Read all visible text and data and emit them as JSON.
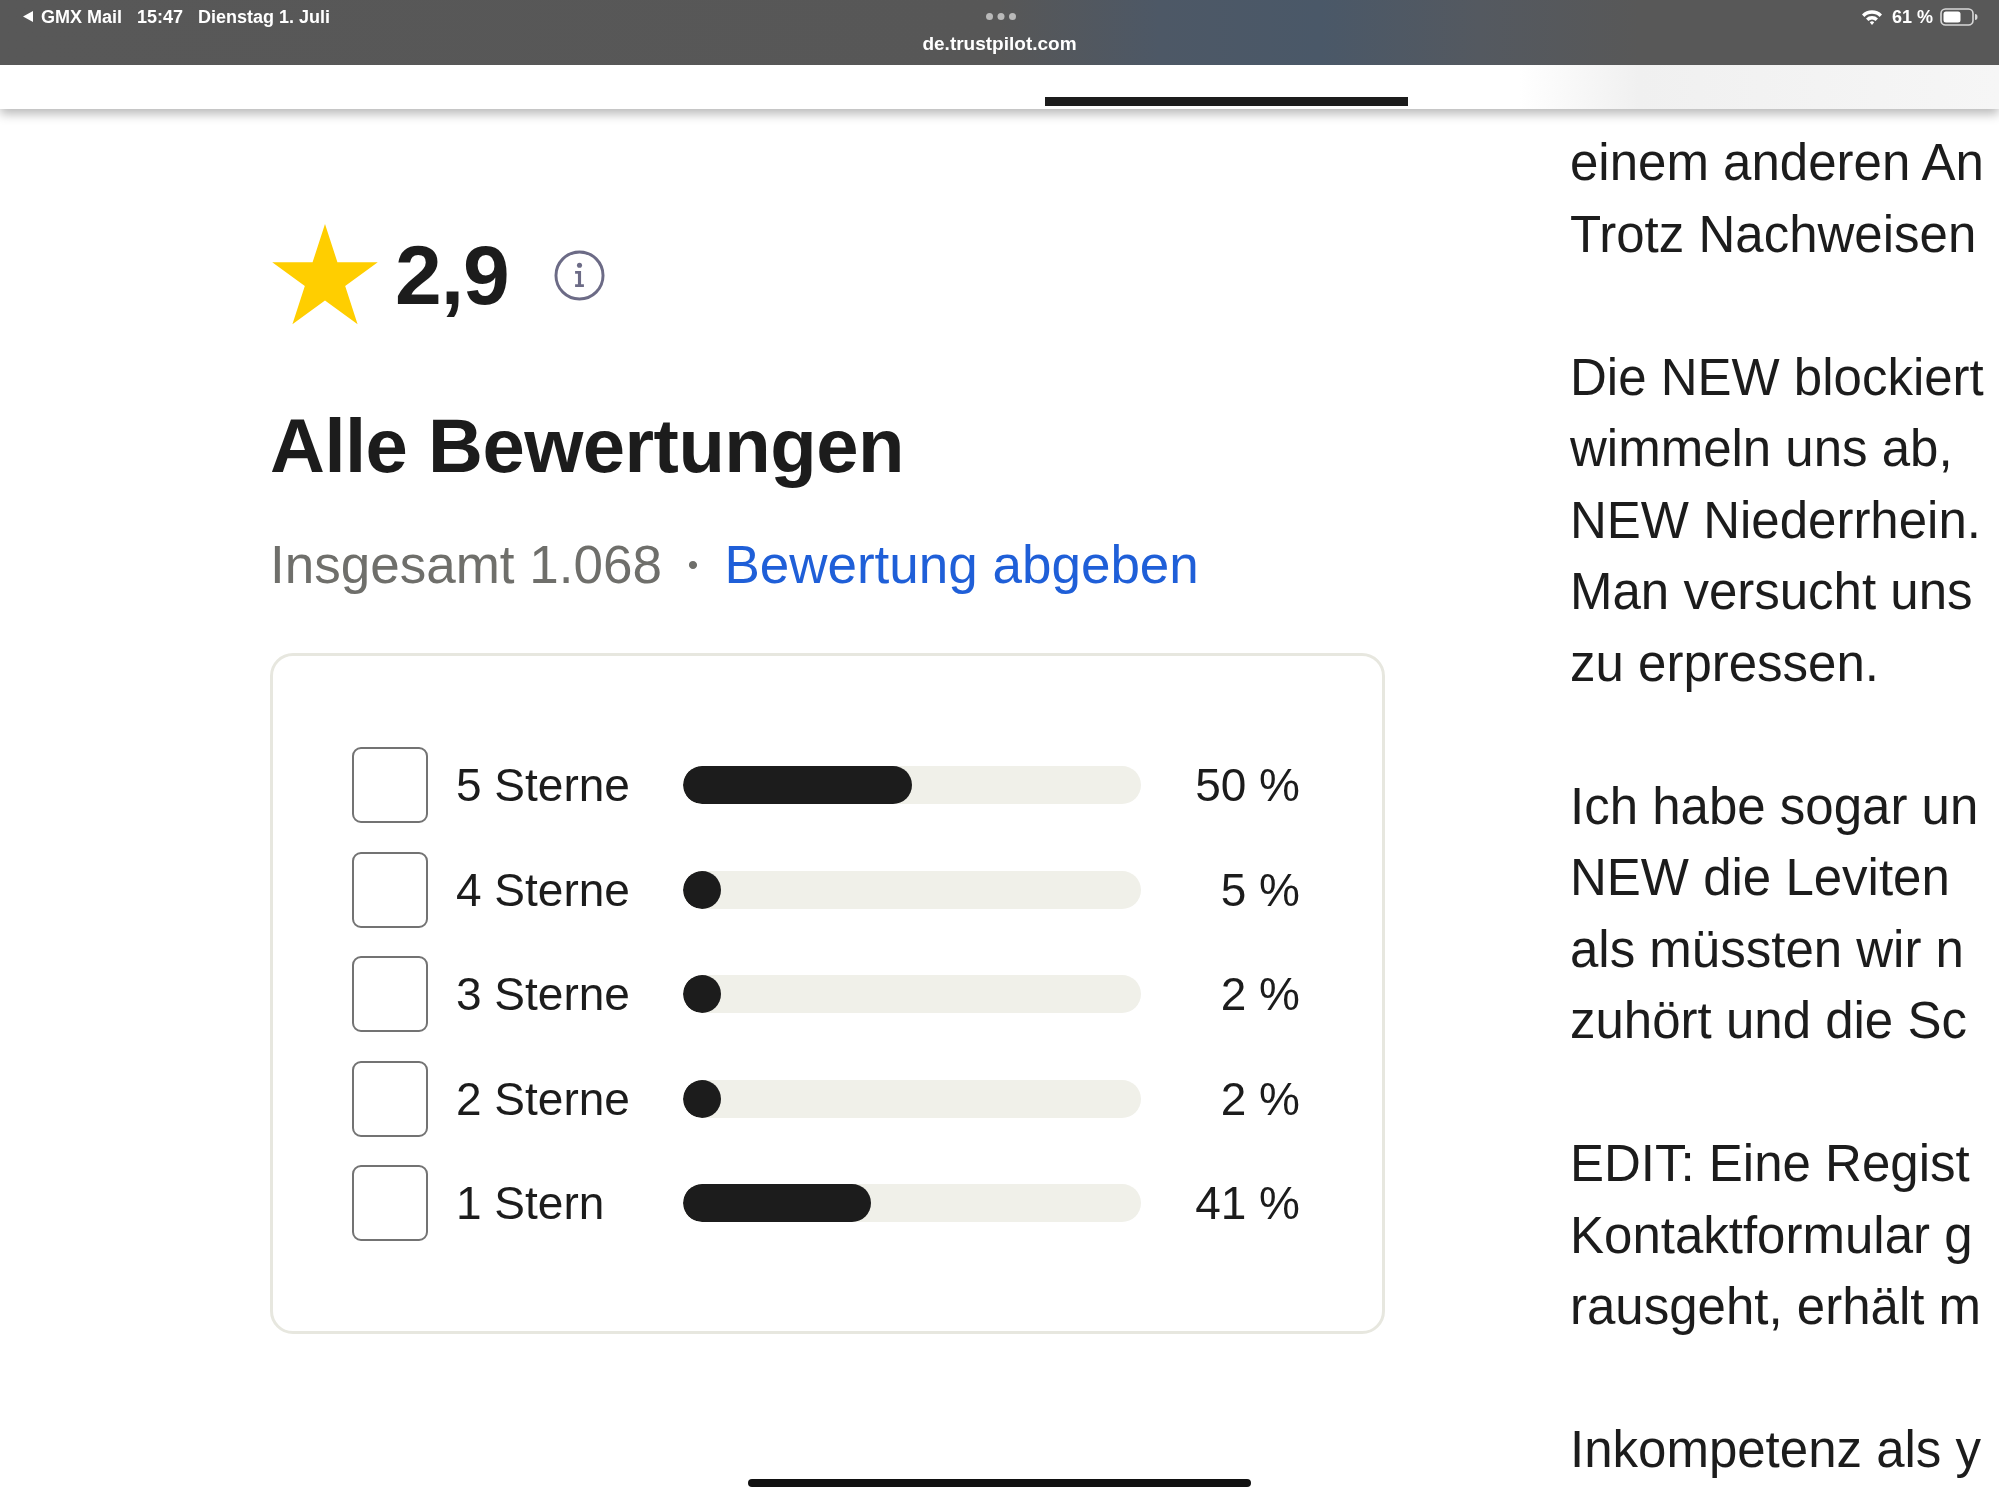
{
  "status_bar": {
    "back_app": "GMX Mail",
    "time": "15:47",
    "date": "Dienstag 1. Juli",
    "url": "de.trustpilot.com",
    "battery": "61 %"
  },
  "rating": {
    "score": "2,9"
  },
  "reviews": {
    "title": "Alle Bewertungen",
    "total": "Insgesamt 1.068",
    "separator": "•",
    "write_review_link": "Bewertung abgeben",
    "distribution": [
      {
        "label": "5 Sterne",
        "checked": false,
        "level": 0.5,
        "percent": "50 %"
      },
      {
        "label": "4 Sterne",
        "checked": false,
        "level": 0.05,
        "percent": "5 %"
      },
      {
        "label": "3 Sterne",
        "checked": false,
        "level": 0.02,
        "percent": "2 %"
      },
      {
        "label": "2 Sterne",
        "checked": false,
        "level": 0.02,
        "percent": "2 %"
      },
      {
        "label": "1 Stern",
        "checked": false,
        "level": 0.41,
        "percent": "41 %"
      }
    ]
  },
  "review_text": {
    "paragraphs": [
      {
        "lines": [
          "einem anderen An",
          "Trotz Nachweisen"
        ]
      },
      {
        "lines": [
          "Die NEW blockiert",
          "wimmeln uns ab,",
          "NEW Niederrhein.",
          "Man versucht uns",
          "zu erpressen."
        ]
      },
      {
        "lines": [
          "Ich habe sogar un",
          "NEW die Leviten",
          "als müssten wir n",
          "zuhört und die Sc"
        ]
      },
      {
        "lines": [
          "EDIT: Eine Regist",
          "Kontaktformular g",
          "rausgeht, erhält m"
        ]
      },
      {
        "lines": [
          "Inkompetenz als y"
        ]
      }
    ]
  }
}
